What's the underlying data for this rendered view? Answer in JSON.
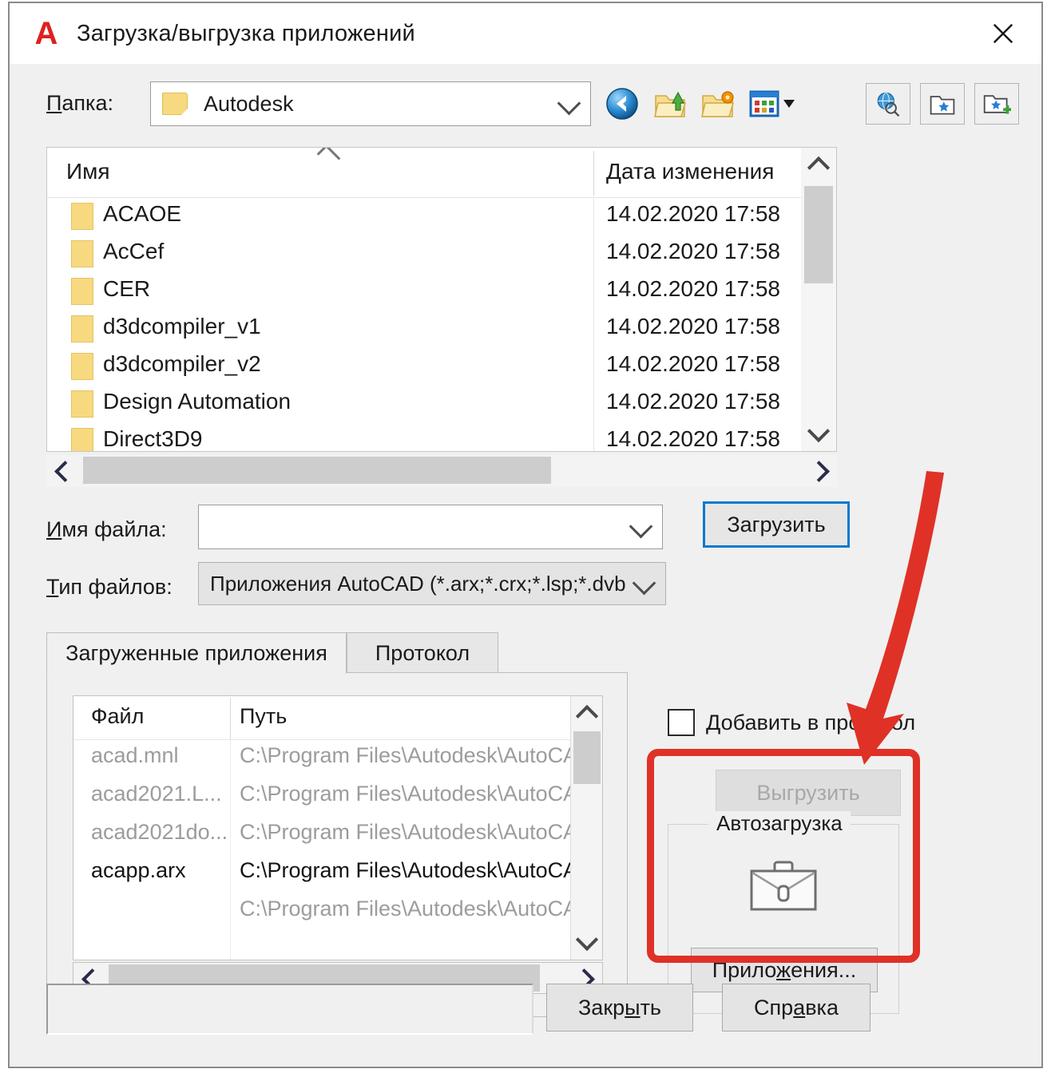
{
  "window": {
    "title": "Загрузка/выгрузка приложений",
    "logo_letter": "A",
    "close_icon": "close-icon",
    "accent_focus": "#0a78d1",
    "annotation_color": "#e03127"
  },
  "folder_bar": {
    "label": "Папка:",
    "label_mnemonic": "П",
    "current_folder": "Autodesk",
    "tools": [
      {
        "name": "back-navigation-icon",
        "title": "Назад"
      },
      {
        "name": "up-one-level-icon",
        "title": "Вверх на один уровень"
      },
      {
        "name": "create-new-folder-icon",
        "title": "Создать папку"
      },
      {
        "name": "views-dropdown-icon",
        "title": "Виды"
      }
    ],
    "right_tools": [
      {
        "name": "search-web-icon"
      },
      {
        "name": "favorites-folder-icon"
      },
      {
        "name": "add-to-favorites-icon"
      }
    ]
  },
  "file_list": {
    "columns": [
      "Имя",
      "Дата изменения"
    ],
    "rows": [
      {
        "name": "ACAOE",
        "date": "14.02.2020 17:58"
      },
      {
        "name": "AcCef",
        "date": "14.02.2020 17:58"
      },
      {
        "name": "CER",
        "date": "14.02.2020 17:58"
      },
      {
        "name": "d3dcompiler_v1",
        "date": "14.02.2020 17:58"
      },
      {
        "name": "d3dcompiler_v2",
        "date": "14.02.2020 17:58"
      },
      {
        "name": "Design Automation",
        "date": "14.02.2020 17:58"
      },
      {
        "name": "Direct3D9",
        "date": "14.02.2020 17:58"
      }
    ]
  },
  "file_name": {
    "label": "Имя файла:",
    "value": "",
    "load_button": "Загрузить"
  },
  "file_type": {
    "label": "Тип файлов:",
    "value": "Приложения AutoCAD (*.arx;*.crx;*.lsp;*.dvb"
  },
  "tabs": [
    {
      "label": "Загруженные приложения",
      "active": true
    },
    {
      "label": "Протокол",
      "active": false
    }
  ],
  "loaded_apps": {
    "columns": [
      "Файл",
      "Путь"
    ],
    "rows": [
      {
        "file": "acad.mnl",
        "path": "C:\\Program Files\\Autodesk\\AutoCA.",
        "state": "dim"
      },
      {
        "file": "acad2021.L...",
        "path": "C:\\Program Files\\Autodesk\\AutoCA.",
        "state": "dim"
      },
      {
        "file": "acad2021do...",
        "path": "C:\\Program Files\\Autodesk\\AutoCA.",
        "state": "dim"
      },
      {
        "file": "acapp.arx",
        "path": "C:\\Program Files\\Autodesk\\AutoCA.",
        "state": "strong"
      },
      {
        "file": "",
        "path": "C:\\Program Files\\Autodesk\\AutoCA.",
        "state": "dim"
      }
    ]
  },
  "right_panel": {
    "add_to_log_label": "Добавить в протокол",
    "add_to_log_checked": false,
    "unload_button": "Выгрузить",
    "unload_disabled": true,
    "autoload_group_title": "Автозагрузка",
    "briefcase_icon": "briefcase-icon",
    "apps_button": "Приложения..."
  },
  "footer": {
    "status_text": "",
    "close_button": "Закрыть",
    "help_button": "Справка"
  }
}
